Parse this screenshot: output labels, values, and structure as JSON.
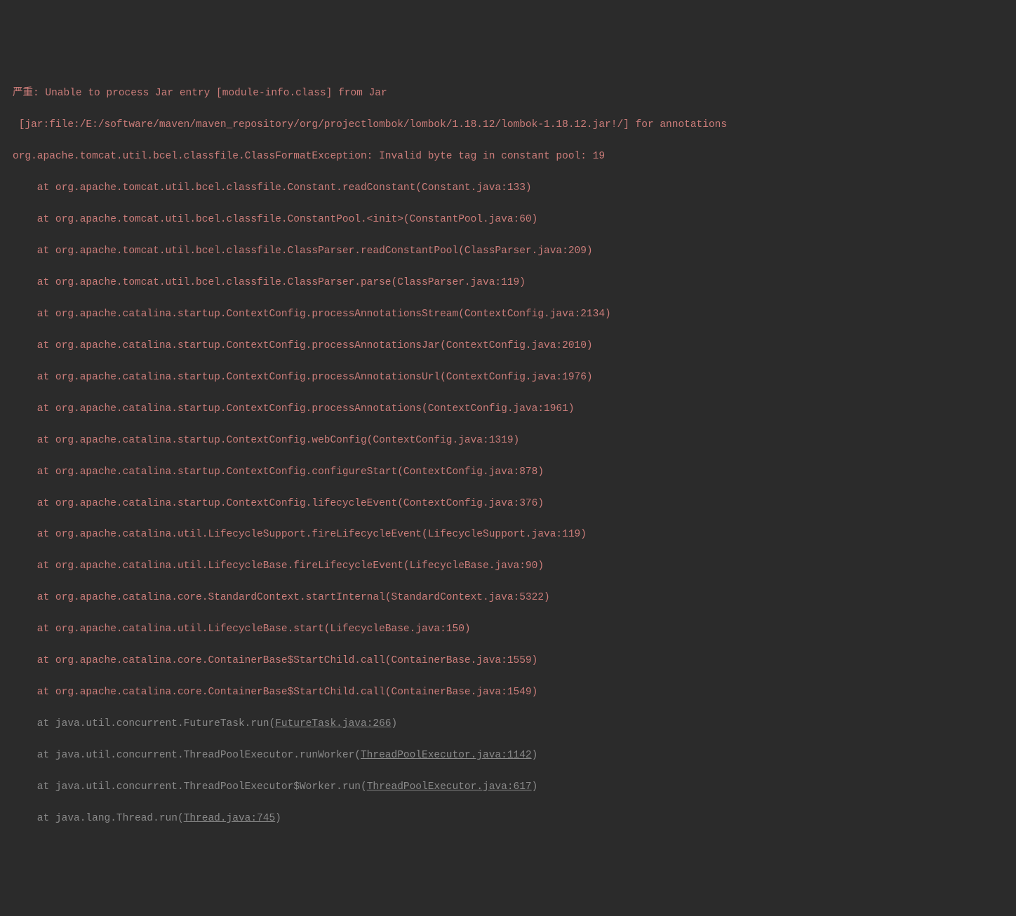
{
  "log": {
    "line1": "严重: Unable to process Jar entry [module-info.class] from Jar",
    "line2": " [jar:file:/E:/software/maven/maven_repository/org/projectlombok/lombok/1.18.12/lombok-1.18.12.jar!/] for annotations",
    "line3": "org.apache.tomcat.util.bcel.classfile.ClassFormatException: Invalid byte tag in constant pool: 19",
    "line4": "    at org.apache.tomcat.util.bcel.classfile.Constant.readConstant(Constant.java:133)",
    "line5": "    at org.apache.tomcat.util.bcel.classfile.ConstantPool.<init>(ConstantPool.java:60)",
    "line6": "    at org.apache.tomcat.util.bcel.classfile.ClassParser.readConstantPool(ClassParser.java:209)",
    "line7": "    at org.apache.tomcat.util.bcel.classfile.ClassParser.parse(ClassParser.java:119)",
    "line8": "    at org.apache.catalina.startup.ContextConfig.processAnnotationsStream(ContextConfig.java:2134)",
    "line9": "    at org.apache.catalina.startup.ContextConfig.processAnnotationsJar(ContextConfig.java:2010)",
    "line10": "    at org.apache.catalina.startup.ContextConfig.processAnnotationsUrl(ContextConfig.java:1976)",
    "line11": "    at org.apache.catalina.startup.ContextConfig.processAnnotations(ContextConfig.java:1961)",
    "line12": "    at org.apache.catalina.startup.ContextConfig.webConfig(ContextConfig.java:1319)",
    "line13": "    at org.apache.catalina.startup.ContextConfig.configureStart(ContextConfig.java:878)",
    "line14": "    at org.apache.catalina.startup.ContextConfig.lifecycleEvent(ContextConfig.java:376)",
    "line15": "    at org.apache.catalina.util.LifecycleSupport.fireLifecycleEvent(LifecycleSupport.java:119)",
    "line16": "    at org.apache.catalina.util.LifecycleBase.fireLifecycleEvent(LifecycleBase.java:90)",
    "line17": "    at org.apache.catalina.core.StandardContext.startInternal(StandardContext.java:5322)",
    "line18": "    at org.apache.catalina.util.LifecycleBase.start(LifecycleBase.java:150)",
    "line19": "    at org.apache.catalina.core.ContainerBase$StartChild.call(ContainerBase.java:1559)",
    "line20": "    at org.apache.catalina.core.ContainerBase$StartChild.call(ContainerBase.java:1549)",
    "line21_pre": "    at java.util.concurrent.FutureTask.run(",
    "line21_link": "FutureTask.java:266",
    "line21_post": ")",
    "line22_pre": "    at java.util.concurrent.ThreadPoolExecutor.runWorker(",
    "line22_link": "ThreadPoolExecutor.java:1142",
    "line22_post": ")",
    "line23_pre": "    at java.util.concurrent.ThreadPoolExecutor$Worker.run(",
    "line23_link": "ThreadPoolExecutor.java:617",
    "line23_post": ")",
    "line24_pre": "    at java.lang.Thread.run(",
    "line24_link": "Thread.java:745",
    "line24_post": ")"
  }
}
